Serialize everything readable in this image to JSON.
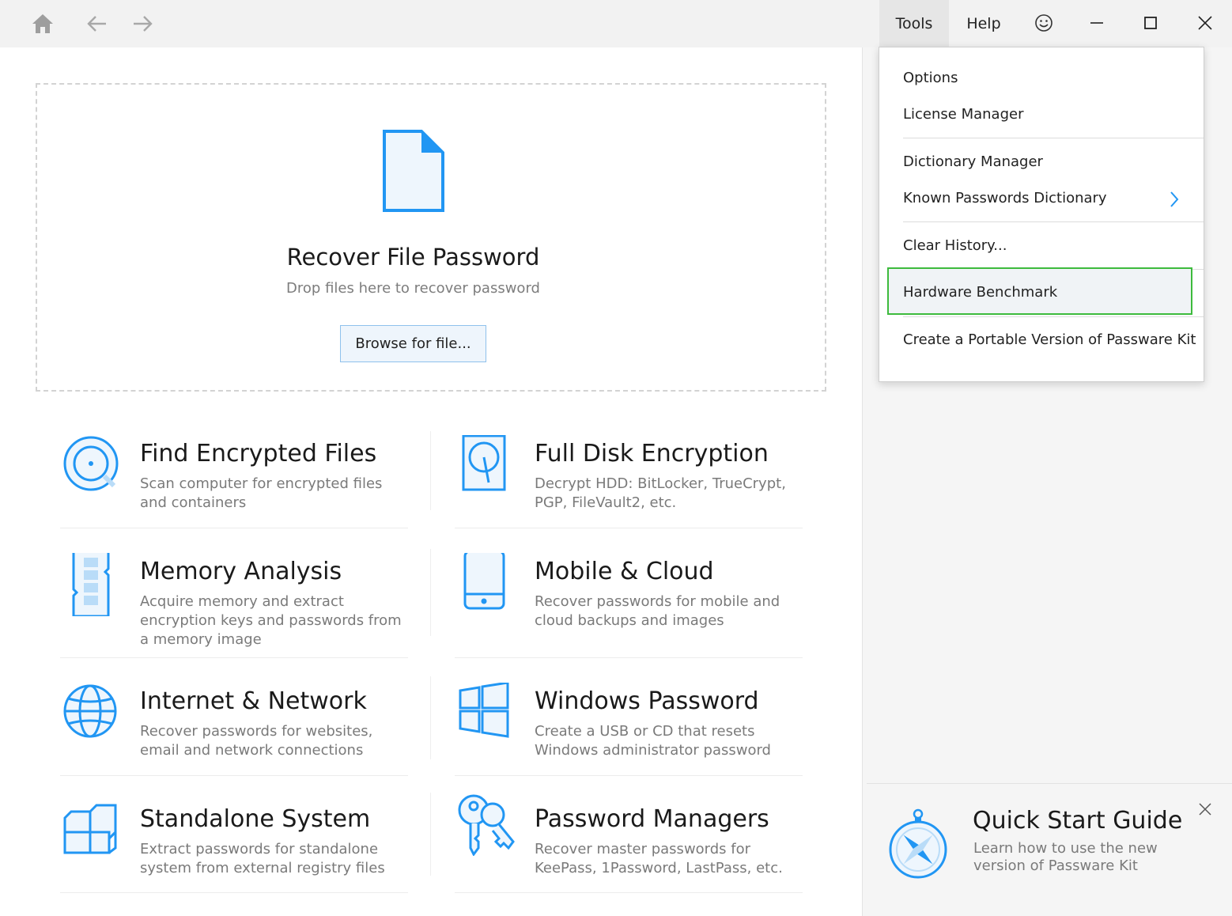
{
  "titlebar": {
    "menu": {
      "tools": "Tools",
      "help": "Help"
    }
  },
  "dropzone": {
    "title": "Recover File Password",
    "subtitle": "Drop files here to recover password",
    "browse_label": "Browse for file..."
  },
  "tiles": [
    {
      "title": "Find Encrypted Files",
      "desc": "Scan computer for encrypted files and containers",
      "icon": "disc-search-icon"
    },
    {
      "title": "Full Disk Encryption",
      "desc": "Decrypt HDD: BitLocker, TrueCrypt, PGP, FileVault2, etc.",
      "icon": "hard-disk-icon"
    },
    {
      "title": "Memory Analysis",
      "desc": "Acquire memory and extract encryption keys and passwords from a memory image",
      "icon": "memory-chip-icon"
    },
    {
      "title": "Mobile & Cloud",
      "desc": "Recover passwords for mobile and cloud backups and images",
      "icon": "tablet-icon"
    },
    {
      "title": "Internet & Network",
      "desc": "Recover passwords for websites, email and network connections",
      "icon": "globe-icon"
    },
    {
      "title": "Windows Password",
      "desc": "Create a USB or CD that resets Windows administrator password",
      "icon": "windows-logo-icon"
    },
    {
      "title": "Standalone System",
      "desc": "Extract passwords for standalone system from external registry files",
      "icon": "cubes-icon"
    },
    {
      "title": "Password Managers",
      "desc": "Recover master passwords for KeePass, 1Password, LastPass, etc.",
      "icon": "keys-icon"
    }
  ],
  "tools_menu": {
    "items": [
      "Options",
      "License Manager",
      "Dictionary Manager",
      "Known Passwords Dictionary",
      "Clear History...",
      "Hardware Benchmark",
      "Create a Portable Version of Passware Kit"
    ],
    "highlighted": "Hardware Benchmark"
  },
  "quick_start": {
    "title": "Quick Start Guide",
    "desc": "Learn how to use the new version of Passware Kit"
  },
  "colors": {
    "accent": "#2196f3",
    "highlight_border": "#3dbb3d"
  }
}
